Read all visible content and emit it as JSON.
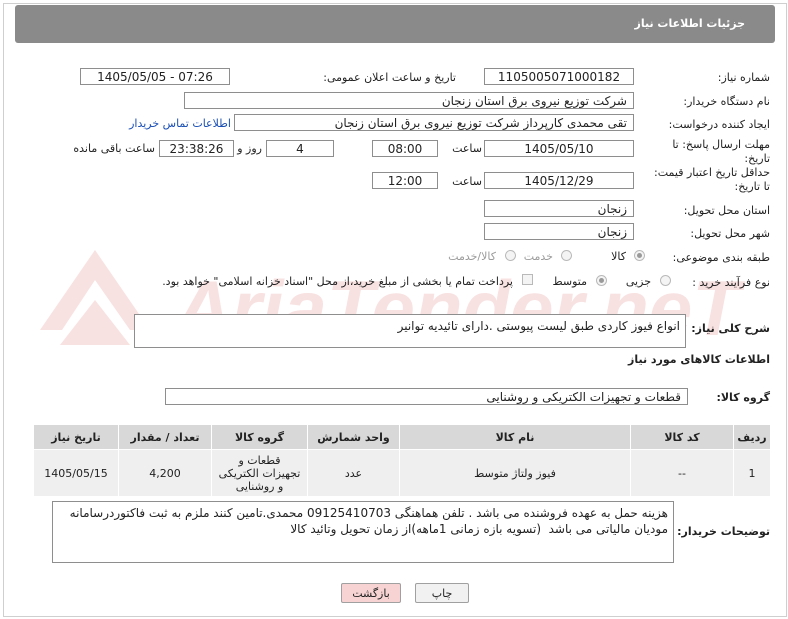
{
  "title": "جزئیات اطلاعات نیاز",
  "fields": {
    "need_number_label": "شماره نیاز:",
    "need_number": "1105005071000182",
    "announce_label": "تاریخ و ساعت اعلان عمومی:",
    "announce_value": "1405/05/05 - 07:26",
    "buyer_org_label": "نام دستگاه خریدار:",
    "buyer_org": "شرکت توزیع نیروی برق استان زنجان",
    "requester_label": "ایجاد کننده درخواست:",
    "requester": "تقی محمدی کارپرداز شرکت توزیع نیروی برق استان زنجان",
    "contact_link": "اطلاعات تماس خریدار",
    "deadline_label_1": "مهلت ارسال پاسخ: تا",
    "deadline_label_2": "تاریخ:",
    "deadline_date": "1405/05/10",
    "time_label": "ساعت",
    "deadline_time": "08:00",
    "days_value": "4",
    "days_label": "روز و",
    "remaining_time": "23:38:26",
    "remaining_label": "ساعت باقی مانده",
    "validity_label_1": "حداقل تاریخ اعتبار قیمت:",
    "validity_label_2": "تا تاریخ:",
    "validity_date": "1405/12/29",
    "validity_time": "12:00",
    "province_label": "استان محل تحویل:",
    "province": "زنجان",
    "city_label": "شهر محل تحویل:",
    "city": "زنجان",
    "category_label": "طبقه بندی موضوعی:",
    "category_options": [
      "کالا",
      "خدمت",
      "کالا/خدمت"
    ],
    "process_label": "نوع فرآیند خرید :",
    "process_options": [
      "جزیی",
      "متوسط"
    ],
    "payment_note": "پرداخت تمام یا بخشی از مبلغ خرید،از محل \"اسناد خزانه اسلامی\" خواهد بود.",
    "description_label": "شرح کلی نیاز:",
    "description": "انواع فیوز کاردی طبق لیست پیوستی .دارای تائیدیه توانیر",
    "goods_info_title": "اطلاعات کالاهای مورد نیاز",
    "goods_group_label": "گروه کالا:",
    "goods_group": "قطعات و تجهیزات الکتریکی و روشنایی"
  },
  "table": {
    "headers": [
      "ردیف",
      "کد کالا",
      "نام کالا",
      "واحد شمارش",
      "گروه کالا",
      "تعداد / مقدار",
      "تاریخ نیاز"
    ],
    "rows": [
      {
        "row": "1",
        "code": "--",
        "name": "فیوز ولتاژ متوسط",
        "unit": "عدد",
        "group": "قطعات و تجهیزات الکتریکی و روشنایی",
        "qty": "4,200",
        "date": "1405/05/15"
      }
    ]
  },
  "buyer_notes_label": "توضیحات خریدار:",
  "buyer_notes": "هزینه حمل به عهده فروشنده می باشد . تلفن هماهنگی 09125410703 محمدی.تامین کنند ملزم به ثبت فاکتوردرسامانه مودیان مالیاتی می باشد  (تسویه بازه زمانی 1ماهه)از زمان تحویل وتائید کالا",
  "buttons": {
    "print": "چاپ",
    "back": "بازگشت"
  },
  "watermark": "AriaTender.neT",
  "colors": {
    "titlebar": "#8a8a8a",
    "link": "#1a4fb5",
    "back_button": "#f7d3d3",
    "watermark": "#f3c9c9"
  }
}
